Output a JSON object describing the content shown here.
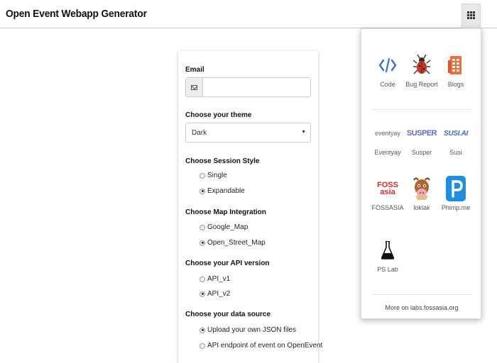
{
  "header": {
    "title": "Open Event Webapp Generator",
    "apps_icon": "grid-icon"
  },
  "form": {
    "email": {
      "label": "Email",
      "value": "",
      "placeholder": "",
      "icon": "envelope-icon"
    },
    "theme": {
      "label": "Choose your theme",
      "selected": "Dark"
    },
    "session_style": {
      "label": "Choose Session Style",
      "options": [
        {
          "label": "Single",
          "checked": false
        },
        {
          "label": "Expandable",
          "checked": true
        }
      ]
    },
    "map": {
      "label": "Choose Map Integration",
      "options": [
        {
          "label": "Google_Map",
          "checked": false
        },
        {
          "label": "Open_Street_Map",
          "checked": true
        }
      ]
    },
    "api": {
      "label": "Choose your API version",
      "options": [
        {
          "label": "API_v1",
          "checked": false
        },
        {
          "label": "API_v2",
          "checked": true
        }
      ]
    },
    "source": {
      "label": "Choose your data source",
      "options": [
        {
          "label": "Upload your own JSON files",
          "checked": true
        },
        {
          "label": "API endpoint of event on OpenEvent",
          "checked": false
        }
      ]
    }
  },
  "apps_menu": {
    "items": [
      {
        "label": "Code",
        "icon": "code-icon"
      },
      {
        "label": "Bug Report",
        "icon": "bug-icon"
      },
      {
        "label": "Blogs",
        "icon": "blog-icon"
      },
      {
        "label": "Eventyay",
        "icon": "eventyay-logo",
        "logo_text": "eventyay"
      },
      {
        "label": "Susper",
        "icon": "susper-logo",
        "logo_text": "SUSPER"
      },
      {
        "label": "Susi",
        "icon": "susi-logo",
        "logo_text": "SUSI.AI"
      },
      {
        "label": "FOSSASIA",
        "icon": "fossasia-logo",
        "logo_text": "FOSS asia"
      },
      {
        "label": "loklak",
        "icon": "loklak-icon"
      },
      {
        "label": "Phimp.me",
        "icon": "phimpme-icon"
      },
      {
        "label": "PS Lab",
        "icon": "pslab-flask-icon"
      }
    ],
    "footer": "More on labs.fossasia.org"
  },
  "colors": {
    "code_blue": "#3b6fd6",
    "blog_orange": "#f26b3a",
    "fossasia_red": "#e02a2a",
    "phimpme_blue": "#1e8fe0",
    "susper_blue": "#5a6ec2"
  }
}
